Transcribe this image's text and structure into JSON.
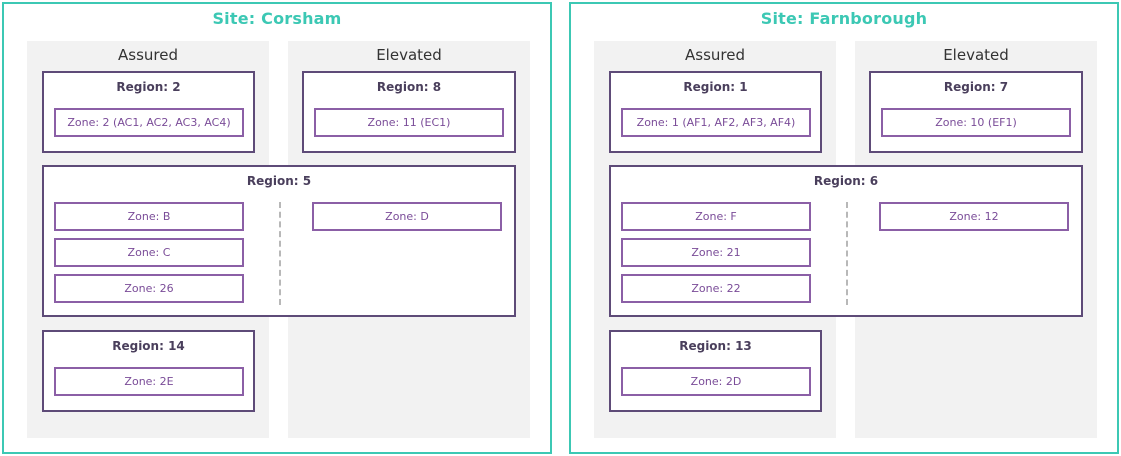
{
  "sites": [
    {
      "title": "Site: Corsham",
      "assured_label": "Assured",
      "elevated_label": "Elevated",
      "regions": {
        "assured_top": {
          "title": "Region: 2",
          "zones": [
            "Zone: 2 (AC1, AC2, AC3, AC4)"
          ]
        },
        "elevated_top": {
          "title": "Region: 8",
          "zones": [
            "Zone: 11 (EC1)"
          ]
        },
        "spanning": {
          "title": "Region: 5",
          "left_zones": [
            "Zone: B",
            "Zone: C",
            "Zone: 26"
          ],
          "right_zones": [
            "Zone: D"
          ]
        },
        "assured_bottom": {
          "title": "Region: 14",
          "zones": [
            "Zone: 2E"
          ]
        }
      }
    },
    {
      "title": "Site: Farnborough",
      "assured_label": "Assured",
      "elevated_label": "Elevated",
      "regions": {
        "assured_top": {
          "title": "Region: 1",
          "zones": [
            "Zone: 1 (AF1, AF2, AF3, AF4)"
          ]
        },
        "elevated_top": {
          "title": "Region: 7",
          "zones": [
            "Zone: 10 (EF1)"
          ]
        },
        "spanning": {
          "title": "Region: 6",
          "left_zones": [
            "Zone: F",
            "Zone: 21",
            "Zone: 22"
          ],
          "right_zones": [
            "Zone: 12"
          ]
        },
        "assured_bottom": {
          "title": "Region: 13",
          "zones": [
            "Zone: 2D"
          ]
        }
      }
    }
  ],
  "colors": {
    "site_border": "#3cc8b4",
    "region_border": "#5e4b78",
    "zone_border": "#8b5fa6",
    "column_fill": "#f2f2f2"
  }
}
